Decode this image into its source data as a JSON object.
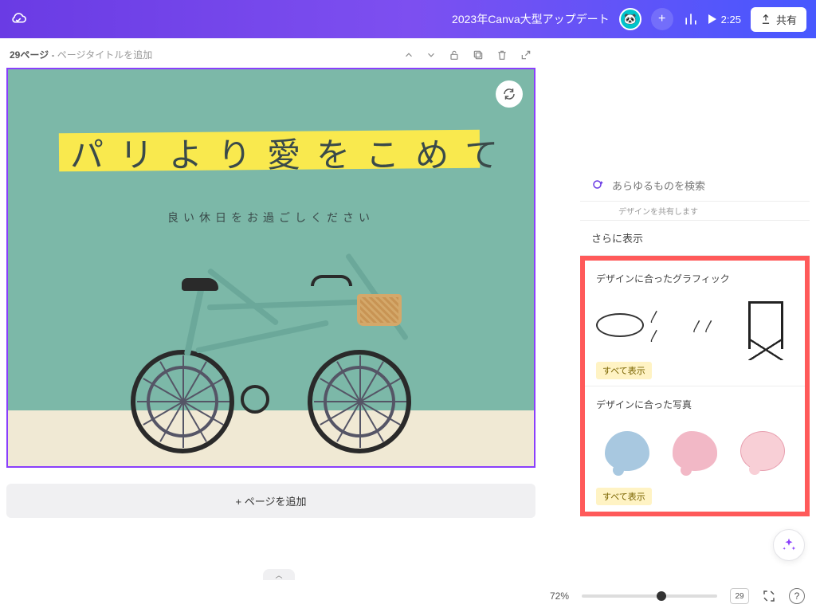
{
  "header": {
    "title": "2023年Canva大型アップデート",
    "time": "2:25",
    "share_label": "共有"
  },
  "page": {
    "label": "29ページ",
    "title_placeholder": "ページタイトルを追加",
    "main_title": "パリより愛をこめて",
    "subtitle": "良い休日をお過ごしください",
    "add_page_label": "+ ページを追加"
  },
  "sidebar": {
    "search_placeholder": "あらゆるものを検索",
    "share_hint": "デザインを共有します",
    "more_label": "さらに表示",
    "graphics_title": "デザインに合ったグラフィック",
    "photos_title": "デザインに合った写真",
    "show_all_label": "すべて表示"
  },
  "footer": {
    "zoom": "72%",
    "page_count": "29"
  }
}
